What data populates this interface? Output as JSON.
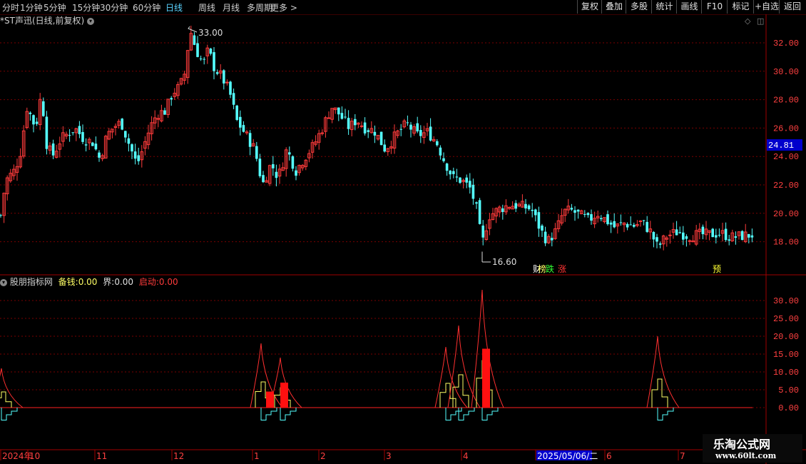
{
  "toolbar": {
    "periods": [
      "分时",
      "1分钟",
      "5分钟",
      "15分钟",
      "30分钟",
      "60分钟",
      "日线",
      "周线",
      "月线",
      "多周期",
      "更多 >"
    ],
    "active_period": "日线",
    "buttons": [
      "复权",
      "叠加",
      "多股",
      "统计",
      "画线",
      "F10",
      "标记",
      "+自选",
      "返回"
    ]
  },
  "main_header": {
    "title": "*ST声迅(日线,前复权)"
  },
  "indicator_header": {
    "name": "股朋指标网",
    "fields": [
      {
        "label": "备钱:",
        "value": "0.00"
      },
      {
        "label": "界:",
        "value": "0.00"
      },
      {
        "label": "启动:",
        "value": "0.00"
      }
    ]
  },
  "colors": {
    "up": "#ff3b3b",
    "down": "#54ffff",
    "grid": "#7a0000",
    "axis": "#a00000",
    "current": "#0000cc",
    "yellow": "#ffff66"
  },
  "annotations": {
    "high": "33.00",
    "low": "16.60",
    "current_price": "24.81",
    "tags": [
      "财",
      "榜",
      "跌",
      "涨",
      "预"
    ]
  },
  "x_axis": {
    "labels": [
      "2024年",
      "10",
      "11",
      "12",
      "1",
      "2",
      "3",
      "4",
      "2025/05/06/二",
      "6",
      "7"
    ]
  },
  "watermark": {
    "title": "乐淘公式网",
    "url": "www.60lt.com"
  },
  "chart_data": [
    {
      "type": "candlestick",
      "title": "*ST声迅(日线,前复权)",
      "ylim": [
        16,
        33.5
      ],
      "yticks": [
        "32.00",
        "30.00",
        "28.00",
        "26.00",
        "24.00",
        "22.00",
        "20.00",
        "18.00"
      ],
      "grid": true,
      "close_anchors": [
        [
          0,
          19.5
        ],
        [
          8,
          22.3
        ],
        [
          20,
          23.0
        ],
        [
          28,
          24.1
        ],
        [
          38,
          27.5
        ],
        [
          50,
          26.0
        ],
        [
          58,
          28.5
        ],
        [
          66,
          24.6
        ],
        [
          75,
          24.1
        ],
        [
          85,
          25.2
        ],
        [
          95,
          25.6
        ],
        [
          105,
          26.0
        ],
        [
          118,
          25.2
        ],
        [
          130,
          25.0
        ],
        [
          140,
          23.8
        ],
        [
          150,
          25.5
        ],
        [
          160,
          26.1
        ],
        [
          170,
          26.4
        ],
        [
          180,
          25.0
        ],
        [
          192,
          23.4
        ],
        [
          200,
          24.5
        ],
        [
          210,
          26.0
        ],
        [
          220,
          27.0
        ],
        [
          232,
          27.2
        ],
        [
          242,
          28.5
        ],
        [
          252,
          28.9
        ],
        [
          260,
          30.0
        ],
        [
          266,
          33.0
        ],
        [
          275,
          31.5
        ],
        [
          285,
          30.5
        ],
        [
          292,
          31.5
        ],
        [
          300,
          30.3
        ],
        [
          312,
          29.5
        ],
        [
          322,
          28.5
        ],
        [
          332,
          26.5
        ],
        [
          345,
          25.5
        ],
        [
          357,
          24.5
        ],
        [
          368,
          22.0
        ],
        [
          380,
          23.5
        ],
        [
          390,
          22.5
        ],
        [
          402,
          24.5
        ],
        [
          415,
          23.0
        ],
        [
          428,
          24.0
        ],
        [
          440,
          24.8
        ],
        [
          452,
          26.0
        ],
        [
          465,
          27.5
        ],
        [
          475,
          27.0
        ],
        [
          490,
          26.0
        ],
        [
          500,
          26.6
        ],
        [
          512,
          26.0
        ],
        [
          525,
          25.8
        ],
        [
          540,
          24.5
        ],
        [
          555,
          25.5
        ],
        [
          570,
          26.3
        ],
        [
          585,
          25.5
        ],
        [
          600,
          25.7
        ],
        [
          612,
          25.0
        ],
        [
          622,
          23.8
        ],
        [
          635,
          22.5
        ],
        [
          648,
          22.3
        ],
        [
          660,
          21.7
        ],
        [
          668,
          20.3
        ],
        [
          676,
          17.8
        ],
        [
          685,
          19.8
        ],
        [
          700,
          20.3
        ],
        [
          715,
          20.6
        ],
        [
          730,
          20.5
        ],
        [
          745,
          20.3
        ],
        [
          758,
          18.8
        ],
        [
          768,
          18.0
        ],
        [
          780,
          18.8
        ],
        [
          790,
          20.1
        ],
        [
          800,
          20.2
        ],
        [
          812,
          19.9
        ],
        [
          825,
          19.5
        ],
        [
          838,
          20.0
        ],
        [
          850,
          19.5
        ],
        [
          862,
          19.0
        ],
        [
          875,
          19.3
        ],
        [
          888,
          19.1
        ],
        [
          900,
          19.4
        ],
        [
          912,
          18.7
        ],
        [
          922,
          17.6
        ],
        [
          935,
          18.4
        ],
        [
          950,
          18.7
        ],
        [
          965,
          18.4
        ],
        [
          980,
          18.5
        ],
        [
          995,
          18.5
        ],
        [
          1010,
          18.6
        ],
        [
          1025,
          18.3
        ],
        [
          1040,
          18.4
        ],
        [
          1058,
          18.5
        ]
      ]
    },
    {
      "type": "bar",
      "title": "股朋指标网",
      "ylim": [
        -5,
        33
      ],
      "yticks": [
        "30.00",
        "25.00",
        "20.00",
        "15.00",
        "10.00",
        "5.00",
        "0.00"
      ],
      "series": [
        {
          "name": "备钱",
          "values": [
            0.0
          ]
        },
        {
          "name": "界",
          "values": [
            0.0
          ]
        },
        {
          "name": "启动",
          "values": [
            0.0
          ]
        }
      ],
      "red_bars": [
        [
          378,
          4.5
        ],
        [
          398,
          7.0
        ],
        [
          681,
          16.5
        ]
      ],
      "peaks": [
        [
          2,
          11.0
        ],
        [
          366,
          18.0
        ],
        [
          393,
          14.0
        ],
        [
          625,
          17.0
        ],
        [
          643,
          23.0
        ],
        [
          676,
          33.0
        ],
        [
          922,
          20.0
        ]
      ]
    }
  ]
}
